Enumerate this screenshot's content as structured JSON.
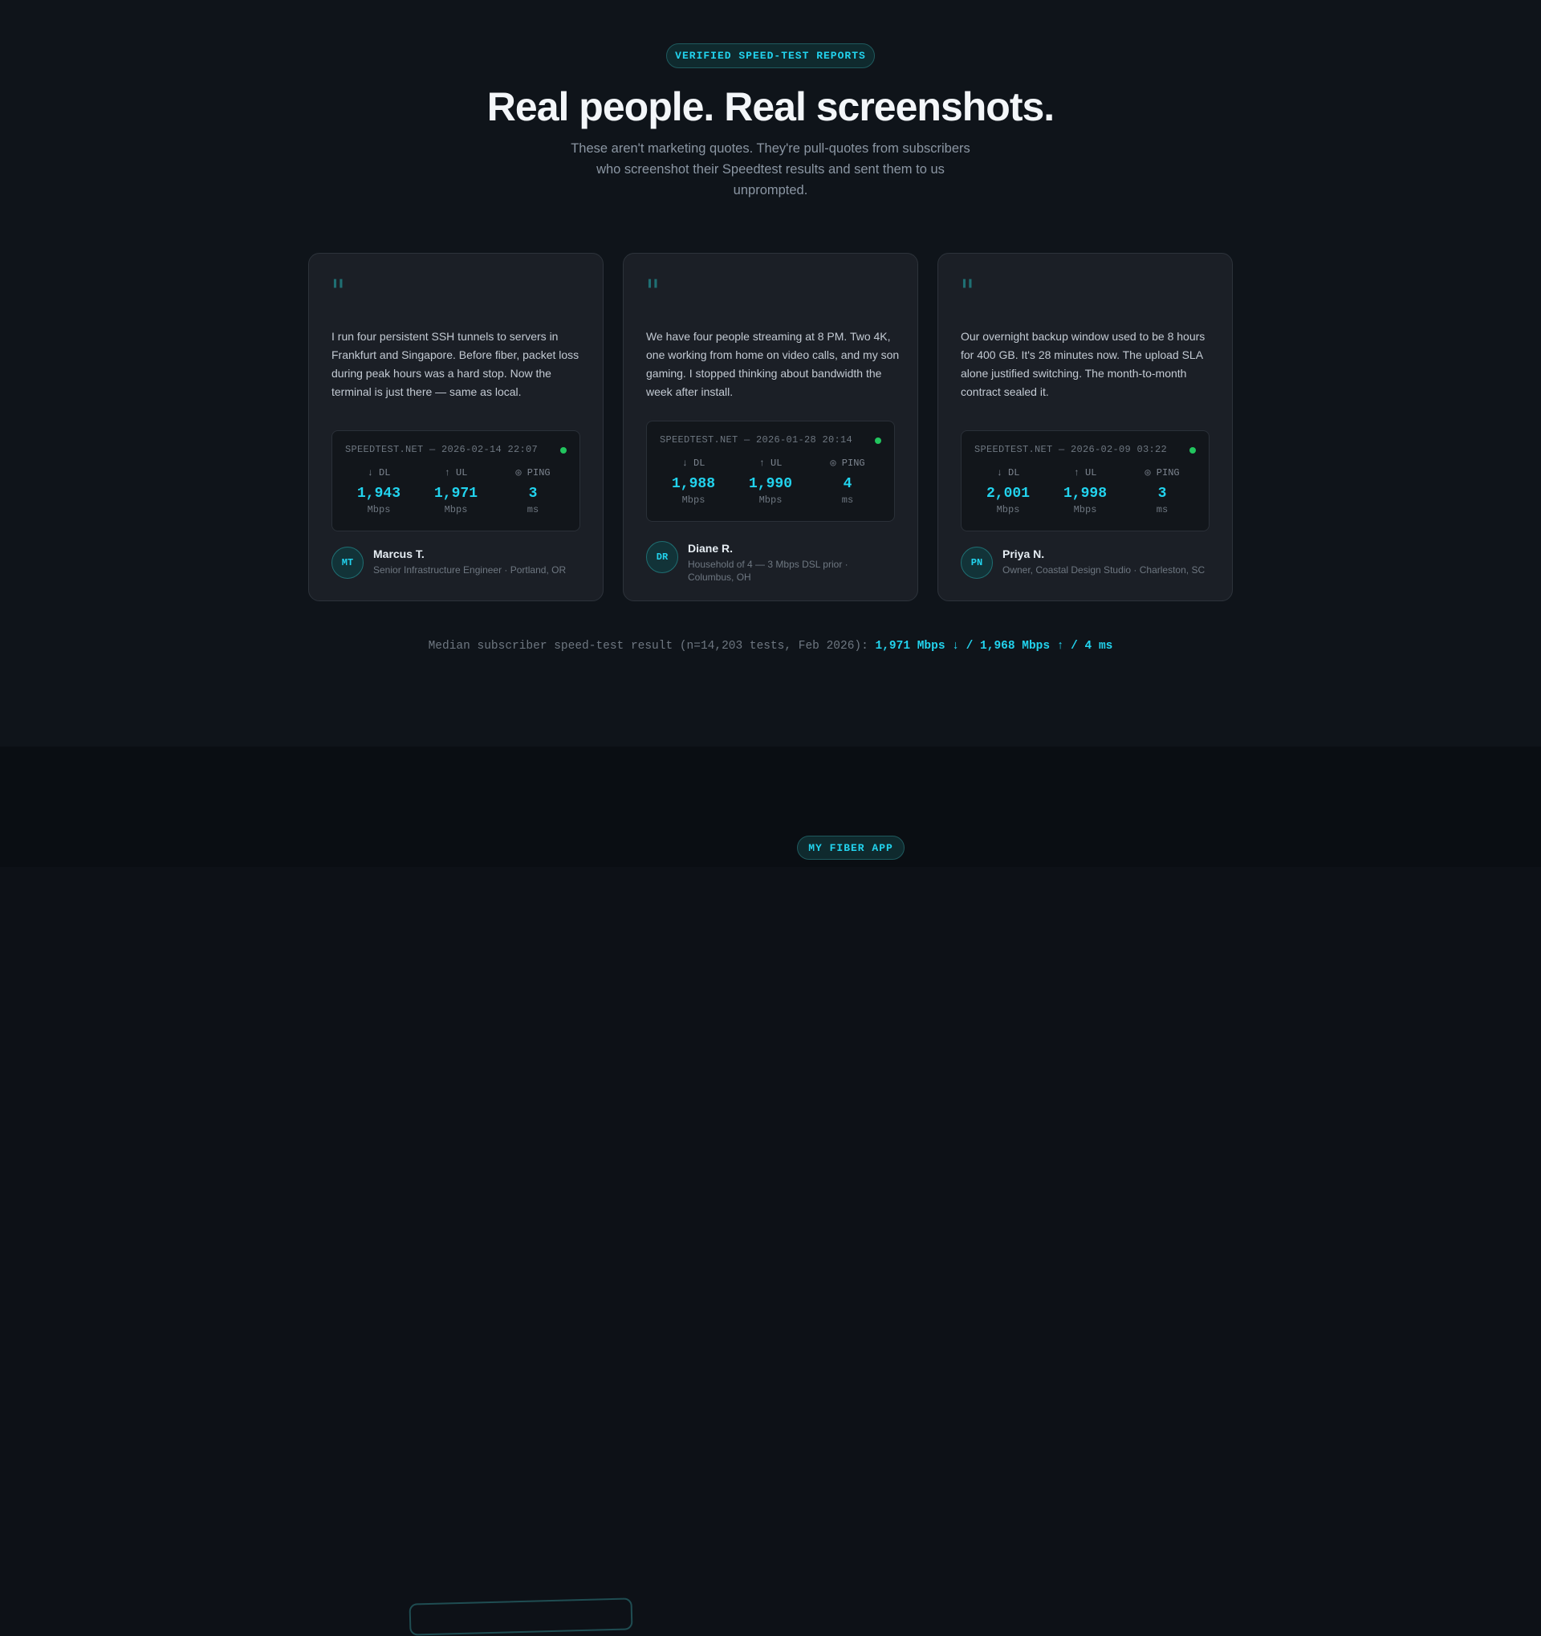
{
  "header": {
    "badge": "VERIFIED SPEED-TEST REPORTS",
    "title": "Real people. Real screenshots.",
    "subtitle": "These aren't marketing quotes. They're pull-quotes from subscribers who screenshot their Speedtest results and sent them to us unprompted."
  },
  "cards": [
    {
      "quote": "I run four persistent SSH tunnels to servers in Frankfurt and Singapore. Before fiber, packet loss during peak hours was a hard stop. Now the terminal is just there — same as local.",
      "test_header": "SPEEDTEST.NET — 2026-02-14 22:07",
      "dl_label": "↓ DL",
      "ul_label": "↑ UL",
      "ping_label": "◎ PING",
      "dl": "1,943",
      "ul": "1,971",
      "ping": "3",
      "dl_unit": "Mbps",
      "ul_unit": "Mbps",
      "ping_unit": "ms",
      "initials": "MT",
      "name": "Marcus T.",
      "role": "Senior Infrastructure Engineer · Portland, OR"
    },
    {
      "quote": "We have four people streaming at 8 PM. Two 4K, one working from home on video calls, and my son gaming. I stopped thinking about bandwidth the week after install.",
      "test_header": "SPEEDTEST.NET — 2026-01-28 20:14",
      "dl_label": "↓ DL",
      "ul_label": "↑ UL",
      "ping_label": "◎ PING",
      "dl": "1,988",
      "ul": "1,990",
      "ping": "4",
      "dl_unit": "Mbps",
      "ul_unit": "Mbps",
      "ping_unit": "ms",
      "initials": "DR",
      "name": "Diane R.",
      "role": "Household of 4 — 3 Mbps DSL prior · Columbus, OH"
    },
    {
      "quote": "Our overnight backup window used to be 8 hours for 400 GB. It's 28 minutes now. The upload SLA alone justified switching. The month-to-month contract sealed it.",
      "test_header": "SPEEDTEST.NET — 2026-02-09 03:22",
      "dl_label": "↓ DL",
      "ul_label": "↑ UL",
      "ping_label": "◎ PING",
      "dl": "2,001",
      "ul": "1,998",
      "ping": "3",
      "dl_unit": "Mbps",
      "ul_unit": "Mbps",
      "ping_unit": "ms",
      "initials": "PN",
      "name": "Priya N.",
      "role": "Owner, Coastal Design Studio · Charleston, SC"
    }
  ],
  "quote_mark": "\"",
  "median": {
    "label": "Median subscriber speed-test result (n=14,203 tests, Feb 2026):",
    "value": "1,971 Mbps ↓ / 1,968 Mbps ↑ / 4 ms"
  },
  "next_section": {
    "badge": "MY FIBER APP"
  },
  "colors": {
    "accent": "#22d3ee",
    "live": "#22c55e",
    "background": "#0f141a"
  }
}
